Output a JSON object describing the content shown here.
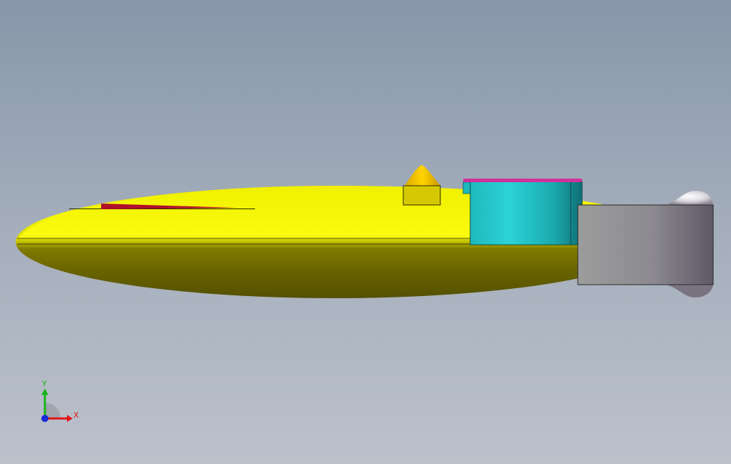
{
  "viewport": {
    "background_top": "#8797a9",
    "background_bottom": "#bcc2cc"
  },
  "model": {
    "body_color": "#f3f300",
    "body_shadow_color": "#5a5400",
    "marker_color": "#b0102c",
    "tank_color": "#22c8cc",
    "tank_cap_color": "#d0309a",
    "block_color": "#8e8c94",
    "nose_cone_color": "#e0b800"
  },
  "triad": {
    "y_label": "Y",
    "x_label": "X",
    "y_color": "#17b317",
    "x_color": "#e01616",
    "z_color": "#1a2ad6"
  }
}
